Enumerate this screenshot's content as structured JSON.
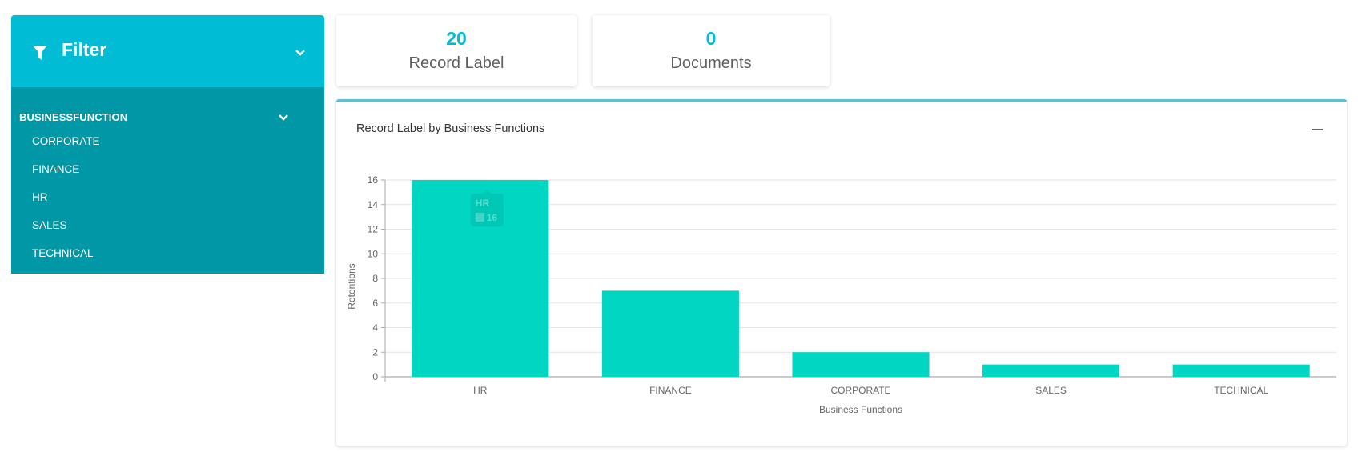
{
  "filter": {
    "title": "Filter",
    "icon": "filter-funnel-icon",
    "section": {
      "title": "BUSINESSFUNCTION",
      "items": [
        "CORPORATE",
        "FINANCE",
        "HR",
        "SALES",
        "TECHNICAL"
      ]
    }
  },
  "stats": [
    {
      "value": "20",
      "label": "Record Label"
    },
    {
      "value": "0",
      "label": "Documents"
    }
  ],
  "chart_card": {
    "title": "Record Label by Business Functions",
    "minimize_icon": "minimize-icon"
  },
  "colors": {
    "filter_header": "#00bcd4",
    "filter_body": "#0097a7",
    "accent": "#00bcd4",
    "bar": "#00d6c2",
    "card_border": "#5bc0de"
  },
  "chart_data": {
    "type": "bar",
    "title": "Record Label by Business Functions",
    "xlabel": "Business Functions",
    "ylabel": "Retentions",
    "categories": [
      "HR",
      "FINANCE",
      "CORPORATE",
      "SALES",
      "TECHNICAL"
    ],
    "values": [
      16,
      7,
      2,
      1,
      1
    ],
    "ylim": [
      0,
      16
    ],
    "yticks": [
      0,
      2,
      4,
      6,
      8,
      10,
      12,
      14,
      16
    ],
    "grid": true,
    "legend": "none",
    "tooltip": {
      "category": "HR",
      "value": "16"
    }
  }
}
